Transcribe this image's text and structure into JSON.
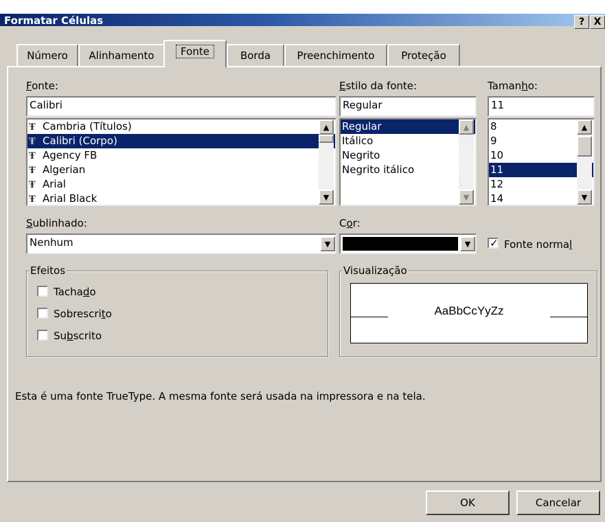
{
  "window": {
    "title": "Formatar Células",
    "help_label": "?",
    "close_label": "X"
  },
  "tabs": [
    "Número",
    "Alinhamento",
    "Fonte",
    "Borda",
    "Preenchimento",
    "Proteção"
  ],
  "font": {
    "label": "Fonte:",
    "value": "Calibri",
    "items": [
      "Cambria (Títulos)",
      "Calibri (Corpo)",
      "Agency FB",
      "Algerian",
      "Arial",
      "Arial Black"
    ],
    "item_icon": "truetype-icon"
  },
  "style": {
    "label": "Estilo da fonte:",
    "value": "Regular",
    "items": [
      "Regular",
      "Itálico",
      "Negrito",
      "Negrito itálico"
    ]
  },
  "size": {
    "label": "Tamanho:",
    "value": "11",
    "items": [
      "8",
      "9",
      "10",
      "11",
      "12",
      "14"
    ]
  },
  "underline": {
    "label": "Sublinhado:",
    "value": "Nenhum"
  },
  "color": {
    "label": "Cor:",
    "value_color": "#000000"
  },
  "normal_font": {
    "label": "Fonte normal",
    "checked": true
  },
  "effects": {
    "label": "Efeitos",
    "strikethrough": "Tachado",
    "superscript": "Sobrescrito",
    "subscript": "Subscrito"
  },
  "preview": {
    "label": "Visualização",
    "sample": "AaBbCcYyZz"
  },
  "info_text": "Esta é uma fonte TrueType. A mesma fonte será usada na impressora e na tela.",
  "buttons": {
    "ok": "OK",
    "cancel": "Cancelar"
  },
  "colors": {
    "title_start": "#0a246a",
    "title_end": "#a6caf0",
    "selection": "#0a246a",
    "face": "#d4d0c8"
  }
}
